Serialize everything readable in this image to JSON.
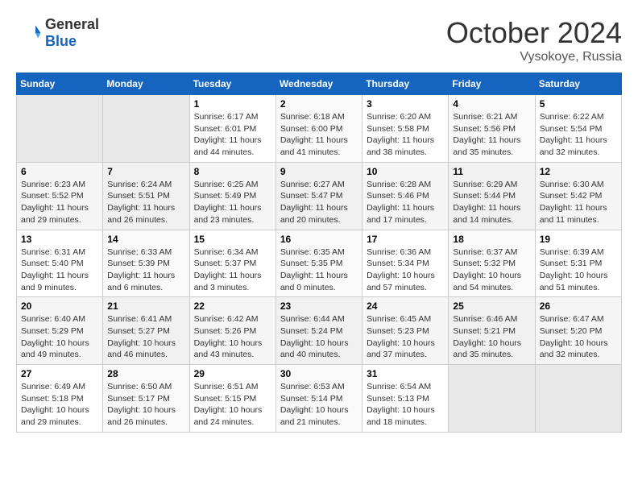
{
  "header": {
    "logo_general": "General",
    "logo_blue": "Blue",
    "month_title": "October 2024",
    "location": "Vysokoye, Russia"
  },
  "days_of_week": [
    "Sunday",
    "Monday",
    "Tuesday",
    "Wednesday",
    "Thursday",
    "Friday",
    "Saturday"
  ],
  "weeks": [
    [
      {
        "day": "",
        "info": ""
      },
      {
        "day": "",
        "info": ""
      },
      {
        "day": "1",
        "info": "Sunrise: 6:17 AM\nSunset: 6:01 PM\nDaylight: 11 hours and 44 minutes."
      },
      {
        "day": "2",
        "info": "Sunrise: 6:18 AM\nSunset: 6:00 PM\nDaylight: 11 hours and 41 minutes."
      },
      {
        "day": "3",
        "info": "Sunrise: 6:20 AM\nSunset: 5:58 PM\nDaylight: 11 hours and 38 minutes."
      },
      {
        "day": "4",
        "info": "Sunrise: 6:21 AM\nSunset: 5:56 PM\nDaylight: 11 hours and 35 minutes."
      },
      {
        "day": "5",
        "info": "Sunrise: 6:22 AM\nSunset: 5:54 PM\nDaylight: 11 hours and 32 minutes."
      }
    ],
    [
      {
        "day": "6",
        "info": "Sunrise: 6:23 AM\nSunset: 5:52 PM\nDaylight: 11 hours and 29 minutes."
      },
      {
        "day": "7",
        "info": "Sunrise: 6:24 AM\nSunset: 5:51 PM\nDaylight: 11 hours and 26 minutes."
      },
      {
        "day": "8",
        "info": "Sunrise: 6:25 AM\nSunset: 5:49 PM\nDaylight: 11 hours and 23 minutes."
      },
      {
        "day": "9",
        "info": "Sunrise: 6:27 AM\nSunset: 5:47 PM\nDaylight: 11 hours and 20 minutes."
      },
      {
        "day": "10",
        "info": "Sunrise: 6:28 AM\nSunset: 5:46 PM\nDaylight: 11 hours and 17 minutes."
      },
      {
        "day": "11",
        "info": "Sunrise: 6:29 AM\nSunset: 5:44 PM\nDaylight: 11 hours and 14 minutes."
      },
      {
        "day": "12",
        "info": "Sunrise: 6:30 AM\nSunset: 5:42 PM\nDaylight: 11 hours and 11 minutes."
      }
    ],
    [
      {
        "day": "13",
        "info": "Sunrise: 6:31 AM\nSunset: 5:40 PM\nDaylight: 11 hours and 9 minutes."
      },
      {
        "day": "14",
        "info": "Sunrise: 6:33 AM\nSunset: 5:39 PM\nDaylight: 11 hours and 6 minutes."
      },
      {
        "day": "15",
        "info": "Sunrise: 6:34 AM\nSunset: 5:37 PM\nDaylight: 11 hours and 3 minutes."
      },
      {
        "day": "16",
        "info": "Sunrise: 6:35 AM\nSunset: 5:35 PM\nDaylight: 11 hours and 0 minutes."
      },
      {
        "day": "17",
        "info": "Sunrise: 6:36 AM\nSunset: 5:34 PM\nDaylight: 10 hours and 57 minutes."
      },
      {
        "day": "18",
        "info": "Sunrise: 6:37 AM\nSunset: 5:32 PM\nDaylight: 10 hours and 54 minutes."
      },
      {
        "day": "19",
        "info": "Sunrise: 6:39 AM\nSunset: 5:31 PM\nDaylight: 10 hours and 51 minutes."
      }
    ],
    [
      {
        "day": "20",
        "info": "Sunrise: 6:40 AM\nSunset: 5:29 PM\nDaylight: 10 hours and 49 minutes."
      },
      {
        "day": "21",
        "info": "Sunrise: 6:41 AM\nSunset: 5:27 PM\nDaylight: 10 hours and 46 minutes."
      },
      {
        "day": "22",
        "info": "Sunrise: 6:42 AM\nSunset: 5:26 PM\nDaylight: 10 hours and 43 minutes."
      },
      {
        "day": "23",
        "info": "Sunrise: 6:44 AM\nSunset: 5:24 PM\nDaylight: 10 hours and 40 minutes."
      },
      {
        "day": "24",
        "info": "Sunrise: 6:45 AM\nSunset: 5:23 PM\nDaylight: 10 hours and 37 minutes."
      },
      {
        "day": "25",
        "info": "Sunrise: 6:46 AM\nSunset: 5:21 PM\nDaylight: 10 hours and 35 minutes."
      },
      {
        "day": "26",
        "info": "Sunrise: 6:47 AM\nSunset: 5:20 PM\nDaylight: 10 hours and 32 minutes."
      }
    ],
    [
      {
        "day": "27",
        "info": "Sunrise: 6:49 AM\nSunset: 5:18 PM\nDaylight: 10 hours and 29 minutes."
      },
      {
        "day": "28",
        "info": "Sunrise: 6:50 AM\nSunset: 5:17 PM\nDaylight: 10 hours and 26 minutes."
      },
      {
        "day": "29",
        "info": "Sunrise: 6:51 AM\nSunset: 5:15 PM\nDaylight: 10 hours and 24 minutes."
      },
      {
        "day": "30",
        "info": "Sunrise: 6:53 AM\nSunset: 5:14 PM\nDaylight: 10 hours and 21 minutes."
      },
      {
        "day": "31",
        "info": "Sunrise: 6:54 AM\nSunset: 5:13 PM\nDaylight: 10 hours and 18 minutes."
      },
      {
        "day": "",
        "info": ""
      },
      {
        "day": "",
        "info": ""
      }
    ]
  ]
}
